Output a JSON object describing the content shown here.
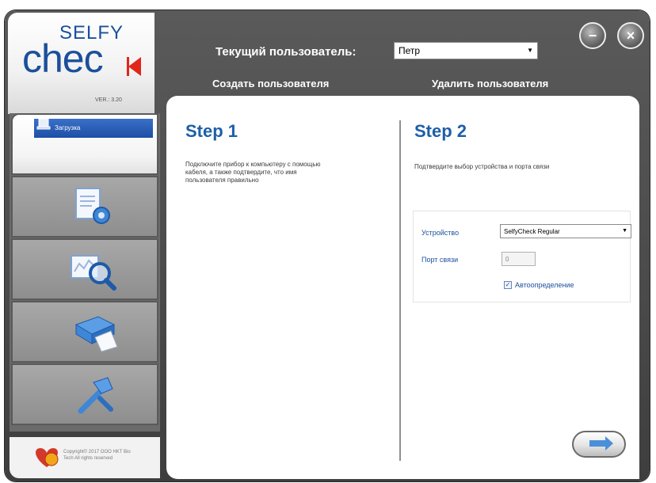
{
  "app": {
    "logo_top": "SELFY",
    "logo_main": "chec",
    "version": "VER.: 3.20"
  },
  "header": {
    "current_user_label": "Текущий пользователь:",
    "current_user_value": "Петр",
    "create_user": "Создать пользователя",
    "delete_user": "Удалить пользователя"
  },
  "window_controls": {
    "minimize_glyph": "−",
    "close_glyph": "×"
  },
  "sidebar": {
    "items": [
      {
        "label": "Загрузка",
        "icon": "download-device-icon",
        "active": true
      },
      {
        "label": "",
        "icon": "document-settings-icon",
        "active": false
      },
      {
        "label": "",
        "icon": "chart-search-icon",
        "active": false
      },
      {
        "label": "",
        "icon": "printer-icon",
        "active": false
      },
      {
        "label": "",
        "icon": "tools-icon",
        "active": false
      }
    ]
  },
  "step1": {
    "title": "Step 1",
    "text_lines": [
      "Подключите прибор к компьютеру с помощью",
      "кабеля, а также подтвердите, что имя",
      "пользователя правильно"
    ]
  },
  "step2": {
    "title": "Step 2",
    "text": "Подтвердите выбор устройства  и порта связи",
    "device_label": "Устройство",
    "device_value": "SelfyCheck Regular",
    "port_label": "Порт связи",
    "port_value": "0",
    "auto_detect_label": "Автоопределение",
    "auto_detect_checked": true
  },
  "footer": {
    "copyright_lines": [
      "Copyright© 2017 OOO HKT Bio",
      "Tech All rights reserved"
    ]
  },
  "colors": {
    "brand_blue": "#1b4f9c",
    "accent_red": "#e0261b",
    "title_blue": "#1d5fa8",
    "window_gray": "#4a4a4a"
  }
}
